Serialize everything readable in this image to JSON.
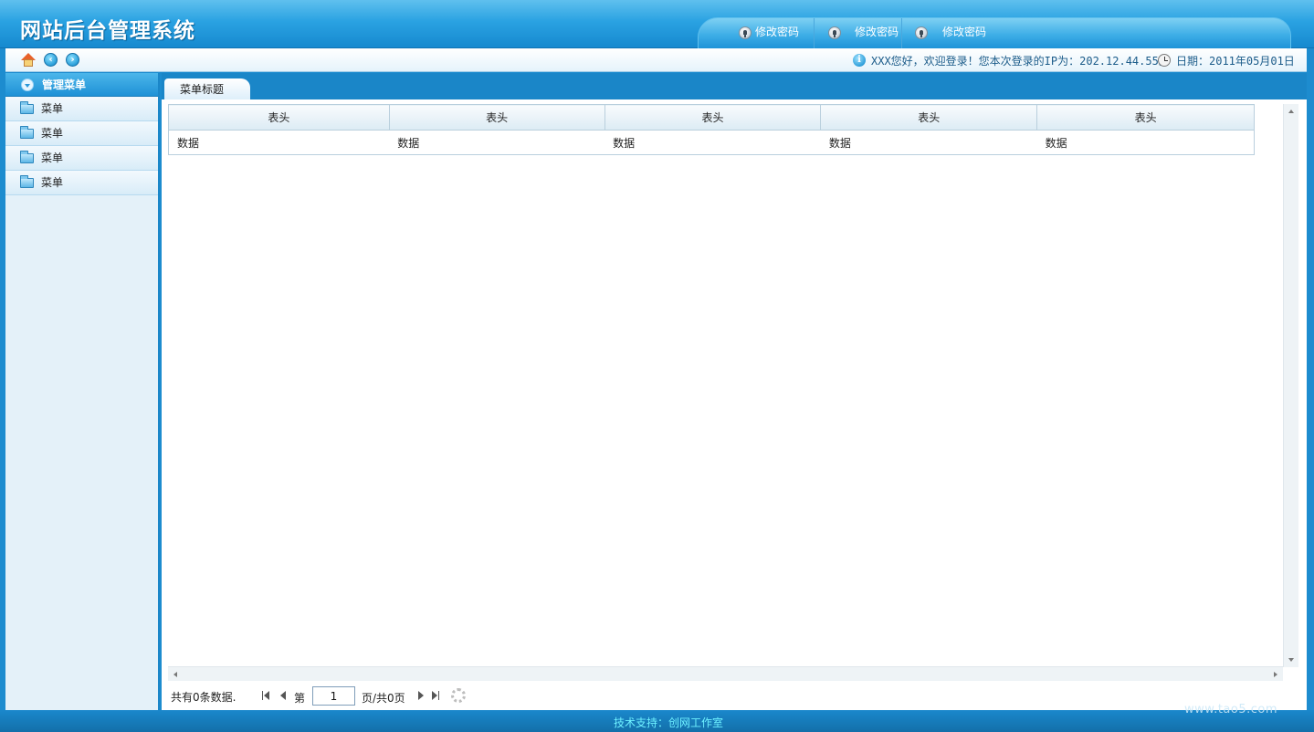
{
  "header": {
    "title": "网站后台管理系统",
    "nav": [
      {
        "label": "修改密码",
        "icon": "lock-icon"
      },
      {
        "label": "修改密码",
        "icon": "lock-icon"
      },
      {
        "label": "修改密码",
        "icon": "lock-icon"
      }
    ]
  },
  "toolbar": {
    "icons": [
      "home-icon",
      "back-icon",
      "forward-icon"
    ],
    "welcome": "XXX您好，欢迎登录！您本次登录的IP为：202.12.44.55。",
    "date": "日期：2011年05月01日"
  },
  "sidebar": {
    "title": "管理菜单",
    "items": [
      {
        "label": "菜单"
      },
      {
        "label": "菜单"
      },
      {
        "label": "菜单"
      },
      {
        "label": "菜单"
      }
    ]
  },
  "main": {
    "tab_label": "菜单标题",
    "table": {
      "headers": [
        "表头",
        "表头",
        "表头",
        "表头",
        "表头"
      ],
      "rows": [
        [
          "数据",
          "数据",
          "数据",
          "数据",
          "数据"
        ]
      ]
    },
    "pager": {
      "total": "共有0条数据.",
      "di": "第",
      "page_value": "1",
      "pages": "页/共0页"
    }
  },
  "footer": {
    "support": "技术支持：创网工作室",
    "watermark": "www.tao5.com"
  },
  "colors": {
    "header_blue": "#2aa2e2",
    "frame_blue": "#1a86c8",
    "sidebar_bg": "#e4f1f9",
    "footer_text": "#6ef0ff"
  }
}
